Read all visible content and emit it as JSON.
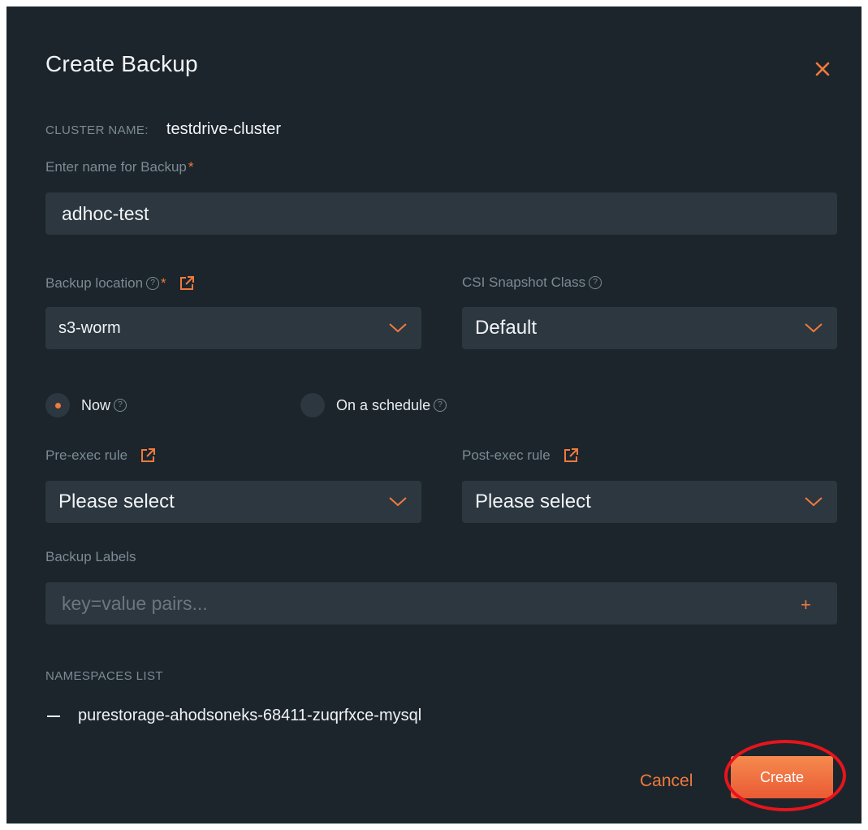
{
  "dialog": {
    "title": "Create Backup",
    "close_icon": "close-icon"
  },
  "cluster": {
    "label": "CLUSTER NAME:",
    "value": "testdrive-cluster"
  },
  "backup_name": {
    "label": "Enter name for Backup",
    "required_mark": "*",
    "value": "adhoc-test"
  },
  "backup_location": {
    "label": "Backup location",
    "help_glyph": "?",
    "required_mark": "*",
    "value": "s3-worm"
  },
  "csi_snapshot_class": {
    "label": "CSI Snapshot Class",
    "help_glyph": "?",
    "value": "Default"
  },
  "timing": {
    "options": [
      {
        "label": "Now",
        "selected": true
      },
      {
        "label": "On a schedule",
        "selected": false
      }
    ]
  },
  "pre_exec_rule": {
    "label": "Pre-exec rule",
    "value": "Please select"
  },
  "post_exec_rule": {
    "label": "Post-exec rule",
    "value": "Please select"
  },
  "backup_labels": {
    "label": "Backup Labels",
    "placeholder": "key=value pairs...",
    "add_glyph": "+"
  },
  "namespaces": {
    "heading": "NAMESPACES LIST",
    "items": [
      "purestorage-ahodsoneks-68411-zuqrfxce-mysql"
    ]
  },
  "actions": {
    "cancel_label": "Cancel",
    "create_label": "Create"
  },
  "colors": {
    "accent": "#f07a3c",
    "background": "#1c252c",
    "field": "#2c3740",
    "highlight": "#e8141c"
  }
}
